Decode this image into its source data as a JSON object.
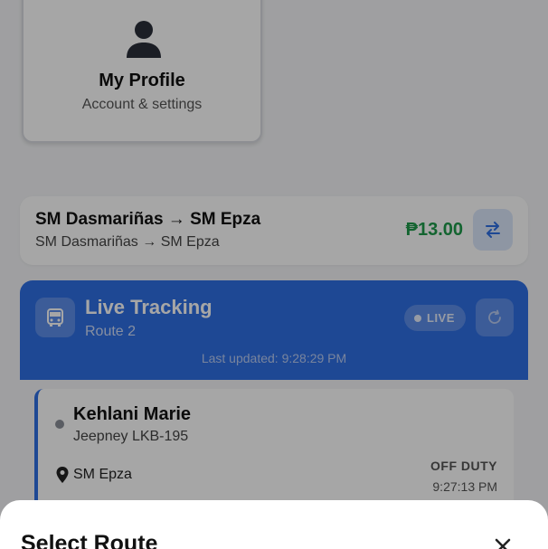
{
  "profile": {
    "title": "My Profile",
    "subtitle": "Account & settings",
    "icon": "person-icon"
  },
  "route": {
    "title": "SM Dasmariñas → SM Epza",
    "subtitle": "SM Dasmariñas → SM Epza",
    "fare": "₱13.00",
    "swap_icon": "swap-icon"
  },
  "live_tracking": {
    "title": "Live Tracking",
    "route": "Route 2",
    "status_pill": "LIVE",
    "last_updated": "Last updated: 9:28:29 PM",
    "icon": "bus-icon",
    "refresh_icon": "refresh-icon"
  },
  "drivers": [
    {
      "name": "Kehlani Marie",
      "vehicle": "Jeepney LKB-195",
      "location": "SM Epza",
      "status": "OFF DUTY",
      "time": "9:27:13 PM"
    }
  ],
  "sheet": {
    "title": "Select Route",
    "close_icon": "close-icon"
  },
  "colors": {
    "accent": "#2f6fe4",
    "fare": "#1e9a4a",
    "overlay": "rgba(0,0,0,0.35)"
  }
}
